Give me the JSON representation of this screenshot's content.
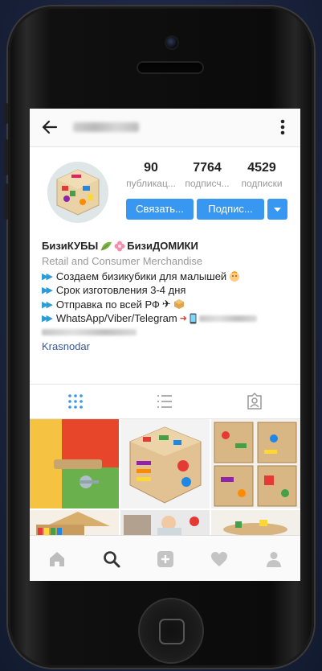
{
  "profile": {
    "stats": [
      {
        "value": "90",
        "label": "публикац..."
      },
      {
        "value": "7764",
        "label": "подписч..."
      },
      {
        "value": "4529",
        "label": "подписки"
      }
    ],
    "buttons": {
      "message": "Связать...",
      "follow": "Подпис..."
    },
    "bio": {
      "name_part1": "БизиКУБЫ",
      "name_part2": "БизиДОМИКИ",
      "category": "Retail and Consumer Merchandise",
      "lines": [
        "Создаем бизикубики для малышей",
        "Срок изготовления 3-4 дня",
        "Отправка по всей РФ",
        "WhatsApp/Viber/Telegram"
      ],
      "location": "Krasnodar"
    }
  },
  "icons": {
    "back": "arrow-left-icon",
    "more": "vertical-dots-icon",
    "grid_tab": "grid-icon",
    "list_tab": "list-icon",
    "tagged_tab": "tagged-person-icon",
    "home": "home-icon",
    "search": "search-icon",
    "add": "plus-square-icon",
    "activity": "heart-icon",
    "profile": "person-icon"
  },
  "colors": {
    "primary_button": "#3897f0",
    "link": "#365899",
    "category_text": "#9a9a9a"
  }
}
